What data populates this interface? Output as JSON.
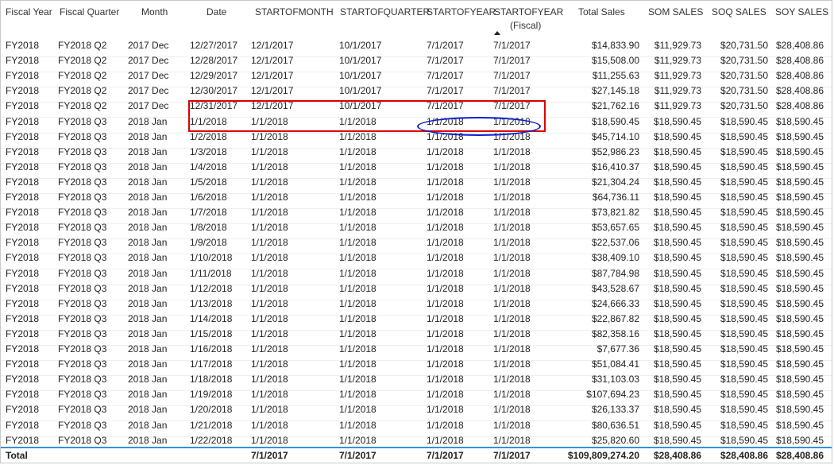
{
  "columns": [
    "Fiscal Year",
    "Fiscal Quarter",
    "Month",
    "Date",
    "STARTOFMONTH",
    "STARTOFQUARTER",
    "STARTOFYEAR",
    "STARTOFYEAR",
    "Total Sales",
    "SOM SALES",
    "SOQ SALES",
    "SOY SALES"
  ],
  "column_subtitle": "(Fiscal)",
  "rows": [
    [
      "FY2018",
      "FY2018 Q2",
      "2017 Dec",
      "12/27/2017",
      "12/1/2017",
      "10/1/2017",
      "7/1/2017",
      "7/1/2017",
      "$14,833.90",
      "$11,929.73",
      "$20,731.50",
      "$28,408.86"
    ],
    [
      "FY2018",
      "FY2018 Q2",
      "2017 Dec",
      "12/28/2017",
      "12/1/2017",
      "10/1/2017",
      "7/1/2017",
      "7/1/2017",
      "$15,508.00",
      "$11,929.73",
      "$20,731.50",
      "$28,408.86"
    ],
    [
      "FY2018",
      "FY2018 Q2",
      "2017 Dec",
      "12/29/2017",
      "12/1/2017",
      "10/1/2017",
      "7/1/2017",
      "7/1/2017",
      "$11,255.63",
      "$11,929.73",
      "$20,731.50",
      "$28,408.86"
    ],
    [
      "FY2018",
      "FY2018 Q2",
      "2017 Dec",
      "12/30/2017",
      "12/1/2017",
      "10/1/2017",
      "7/1/2017",
      "7/1/2017",
      "$27,145.18",
      "$11,929.73",
      "$20,731.50",
      "$28,408.86"
    ],
    [
      "FY2018",
      "FY2018 Q2",
      "2017 Dec",
      "12/31/2017",
      "12/1/2017",
      "10/1/2017",
      "7/1/2017",
      "7/1/2017",
      "$21,762.16",
      "$11,929.73",
      "$20,731.50",
      "$28,408.86"
    ],
    [
      "FY2018",
      "FY2018 Q3",
      "2018 Jan",
      "1/1/2018",
      "1/1/2018",
      "1/1/2018",
      "1/1/2018",
      "1/1/2018",
      "$18,590.45",
      "$18,590.45",
      "$18,590.45",
      "$18,590.45"
    ],
    [
      "FY2018",
      "FY2018 Q3",
      "2018 Jan",
      "1/2/2018",
      "1/1/2018",
      "1/1/2018",
      "1/1/2018",
      "1/1/2018",
      "$45,714.10",
      "$18,590.45",
      "$18,590.45",
      "$18,590.45"
    ],
    [
      "FY2018",
      "FY2018 Q3",
      "2018 Jan",
      "1/3/2018",
      "1/1/2018",
      "1/1/2018",
      "1/1/2018",
      "1/1/2018",
      "$52,986.23",
      "$18,590.45",
      "$18,590.45",
      "$18,590.45"
    ],
    [
      "FY2018",
      "FY2018 Q3",
      "2018 Jan",
      "1/4/2018",
      "1/1/2018",
      "1/1/2018",
      "1/1/2018",
      "1/1/2018",
      "$16,410.37",
      "$18,590.45",
      "$18,590.45",
      "$18,590.45"
    ],
    [
      "FY2018",
      "FY2018 Q3",
      "2018 Jan",
      "1/5/2018",
      "1/1/2018",
      "1/1/2018",
      "1/1/2018",
      "1/1/2018",
      "$21,304.24",
      "$18,590.45",
      "$18,590.45",
      "$18,590.45"
    ],
    [
      "FY2018",
      "FY2018 Q3",
      "2018 Jan",
      "1/6/2018",
      "1/1/2018",
      "1/1/2018",
      "1/1/2018",
      "1/1/2018",
      "$64,736.11",
      "$18,590.45",
      "$18,590.45",
      "$18,590.45"
    ],
    [
      "FY2018",
      "FY2018 Q3",
      "2018 Jan",
      "1/7/2018",
      "1/1/2018",
      "1/1/2018",
      "1/1/2018",
      "1/1/2018",
      "$73,821.82",
      "$18,590.45",
      "$18,590.45",
      "$18,590.45"
    ],
    [
      "FY2018",
      "FY2018 Q3",
      "2018 Jan",
      "1/8/2018",
      "1/1/2018",
      "1/1/2018",
      "1/1/2018",
      "1/1/2018",
      "$53,657.65",
      "$18,590.45",
      "$18,590.45",
      "$18,590.45"
    ],
    [
      "FY2018",
      "FY2018 Q3",
      "2018 Jan",
      "1/9/2018",
      "1/1/2018",
      "1/1/2018",
      "1/1/2018",
      "1/1/2018",
      "$22,537.06",
      "$18,590.45",
      "$18,590.45",
      "$18,590.45"
    ],
    [
      "FY2018",
      "FY2018 Q3",
      "2018 Jan",
      "1/10/2018",
      "1/1/2018",
      "1/1/2018",
      "1/1/2018",
      "1/1/2018",
      "$38,409.10",
      "$18,590.45",
      "$18,590.45",
      "$18,590.45"
    ],
    [
      "FY2018",
      "FY2018 Q3",
      "2018 Jan",
      "1/11/2018",
      "1/1/2018",
      "1/1/2018",
      "1/1/2018",
      "1/1/2018",
      "$87,784.98",
      "$18,590.45",
      "$18,590.45",
      "$18,590.45"
    ],
    [
      "FY2018",
      "FY2018 Q3",
      "2018 Jan",
      "1/12/2018",
      "1/1/2018",
      "1/1/2018",
      "1/1/2018",
      "1/1/2018",
      "$43,528.67",
      "$18,590.45",
      "$18,590.45",
      "$18,590.45"
    ],
    [
      "FY2018",
      "FY2018 Q3",
      "2018 Jan",
      "1/13/2018",
      "1/1/2018",
      "1/1/2018",
      "1/1/2018",
      "1/1/2018",
      "$24,666.33",
      "$18,590.45",
      "$18,590.45",
      "$18,590.45"
    ],
    [
      "FY2018",
      "FY2018 Q3",
      "2018 Jan",
      "1/14/2018",
      "1/1/2018",
      "1/1/2018",
      "1/1/2018",
      "1/1/2018",
      "$22,867.82",
      "$18,590.45",
      "$18,590.45",
      "$18,590.45"
    ],
    [
      "FY2018",
      "FY2018 Q3",
      "2018 Jan",
      "1/15/2018",
      "1/1/2018",
      "1/1/2018",
      "1/1/2018",
      "1/1/2018",
      "$82,358.16",
      "$18,590.45",
      "$18,590.45",
      "$18,590.45"
    ],
    [
      "FY2018",
      "FY2018 Q3",
      "2018 Jan",
      "1/16/2018",
      "1/1/2018",
      "1/1/2018",
      "1/1/2018",
      "1/1/2018",
      "$7,677.36",
      "$18,590.45",
      "$18,590.45",
      "$18,590.45"
    ],
    [
      "FY2018",
      "FY2018 Q3",
      "2018 Jan",
      "1/17/2018",
      "1/1/2018",
      "1/1/2018",
      "1/1/2018",
      "1/1/2018",
      "$51,084.41",
      "$18,590.45",
      "$18,590.45",
      "$18,590.45"
    ],
    [
      "FY2018",
      "FY2018 Q3",
      "2018 Jan",
      "1/18/2018",
      "1/1/2018",
      "1/1/2018",
      "1/1/2018",
      "1/1/2018",
      "$31,103.03",
      "$18,590.45",
      "$18,590.45",
      "$18,590.45"
    ],
    [
      "FY2018",
      "FY2018 Q3",
      "2018 Jan",
      "1/19/2018",
      "1/1/2018",
      "1/1/2018",
      "1/1/2018",
      "1/1/2018",
      "$107,694.23",
      "$18,590.45",
      "$18,590.45",
      "$18,590.45"
    ],
    [
      "FY2018",
      "FY2018 Q3",
      "2018 Jan",
      "1/20/2018",
      "1/1/2018",
      "1/1/2018",
      "1/1/2018",
      "1/1/2018",
      "$26,133.37",
      "$18,590.45",
      "$18,590.45",
      "$18,590.45"
    ],
    [
      "FY2018",
      "FY2018 Q3",
      "2018 Jan",
      "1/21/2018",
      "1/1/2018",
      "1/1/2018",
      "1/1/2018",
      "1/1/2018",
      "$80,636.51",
      "$18,590.45",
      "$18,590.45",
      "$18,590.45"
    ],
    [
      "FY2018",
      "FY2018 Q3",
      "2018 Jan",
      "1/22/2018",
      "1/1/2018",
      "1/1/2018",
      "1/1/2018",
      "1/1/2018",
      "$25,820.60",
      "$18,590.45",
      "$18,590.45",
      "$18,590.45"
    ]
  ],
  "total": {
    "label": "Total",
    "STARTOFMONTH": "7/1/2017",
    "STARTOFQUARTER": "7/1/2017",
    "STARTOFYEAR": "7/1/2017",
    "STARTOFYEAR_fiscal": "7/1/2017",
    "total_sales": "$109,809,274.20",
    "som_sales": "$28,408.86",
    "soq_sales": "$28,408.86",
    "soy_sales": "$28,408.86"
  },
  "sorted_column": "STARTOFYEAR (Fiscal)",
  "sort_direction": "ascending",
  "icons": {
    "sort": "sort-ascending-icon"
  },
  "colors": {
    "highlight_box": "#e00000",
    "highlight_ellipse": "#0a1fd0",
    "total_divider": "#3b8fd6"
  }
}
